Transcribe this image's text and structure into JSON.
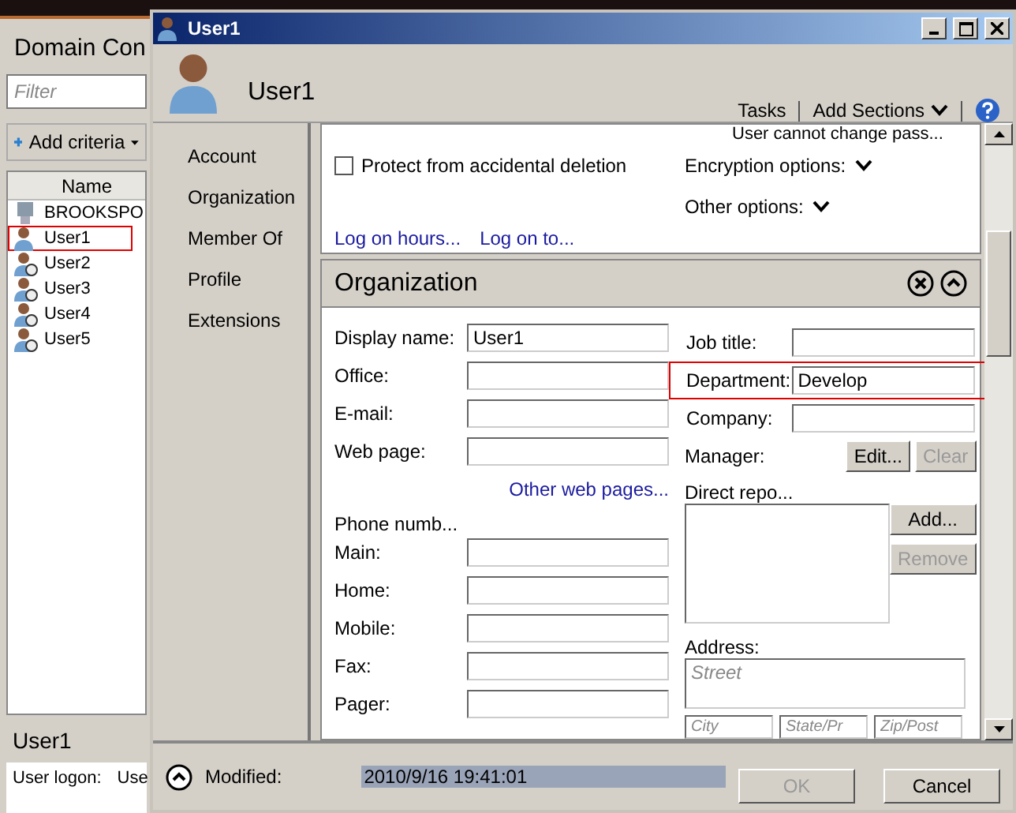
{
  "back_window": {
    "title": "Domain Con",
    "filter": {
      "placeholder": "Filter"
    },
    "add_criteria": "Add criteria",
    "list": {
      "columns": [
        "Name"
      ],
      "rows": [
        {
          "name": "BROOKSPO",
          "kind": "computer",
          "highlighted": false
        },
        {
          "name": "User1",
          "kind": "user",
          "highlighted": true
        },
        {
          "name": "User2",
          "kind": "disabled-user",
          "highlighted": false
        },
        {
          "name": "User3",
          "kind": "disabled-user",
          "highlighted": false
        },
        {
          "name": "User4",
          "kind": "disabled-user",
          "highlighted": false
        },
        {
          "name": "User5",
          "kind": "disabled-user",
          "highlighted": false
        }
      ]
    },
    "details": {
      "title": "User1",
      "fields": [
        {
          "label": "User logon:",
          "value": "Use"
        }
      ]
    }
  },
  "dialog": {
    "title": "User1",
    "header": {
      "name": "User1",
      "tasks": "Tasks",
      "add_sections": "Add Sections"
    },
    "nav": [
      "Account",
      "Organization",
      "Member Of",
      "Profile",
      "Extensions"
    ],
    "account": {
      "top_option": "User cannot change pass...",
      "protect": {
        "label": "Protect from accidental deletion",
        "checked": false
      },
      "encryption": "Encryption options:",
      "other": "Other options:",
      "links": [
        "Log on hours...",
        "Log on to..."
      ]
    },
    "organization": {
      "title": "Organization",
      "left_fields": [
        {
          "label": "Display name:",
          "value": "User1"
        },
        {
          "label": "Office:"
        },
        {
          "label": "E-mail:"
        },
        {
          "label": "Web page:"
        }
      ],
      "other_link": "Other web pages...",
      "phone_title": "Phone numb...",
      "phone_fields": [
        {
          "label": "Main:"
        },
        {
          "label": "Home:"
        },
        {
          "label": "Mobile:"
        },
        {
          "label": "Fax:"
        },
        {
          "label": "Pager:"
        }
      ],
      "right_fields": [
        {
          "label": "Job title:",
          "highlighted": false
        },
        {
          "label": "Department:",
          "value": "Develop",
          "highlighted": true
        },
        {
          "label": "Company:",
          "highlighted": false
        }
      ],
      "manager": {
        "label": "Manager:",
        "buttons": [
          {
            "label": "Edit...",
            "disabled": false
          },
          {
            "label": "Clear",
            "disabled": true
          }
        ]
      },
      "direct_reports": {
        "label": "Direct repo...",
        "buttons": [
          {
            "label": "Add...",
            "disabled": false
          },
          {
            "label": "Remove",
            "disabled": true
          }
        ]
      },
      "address": {
        "label": "Address:",
        "street": {
          "placeholder": "Street"
        },
        "row": [
          {
            "placeholder": "City"
          },
          {
            "placeholder": "State/Pr"
          },
          {
            "placeholder": "Zip/Post"
          }
        ]
      }
    },
    "footer": {
      "label": "Modified:",
      "value": "2010/9/16 19:41:01",
      "buttons": [
        {
          "label": "OK",
          "disabled": true
        },
        {
          "label": "Cancel",
          "disabled": false
        }
      ]
    }
  }
}
